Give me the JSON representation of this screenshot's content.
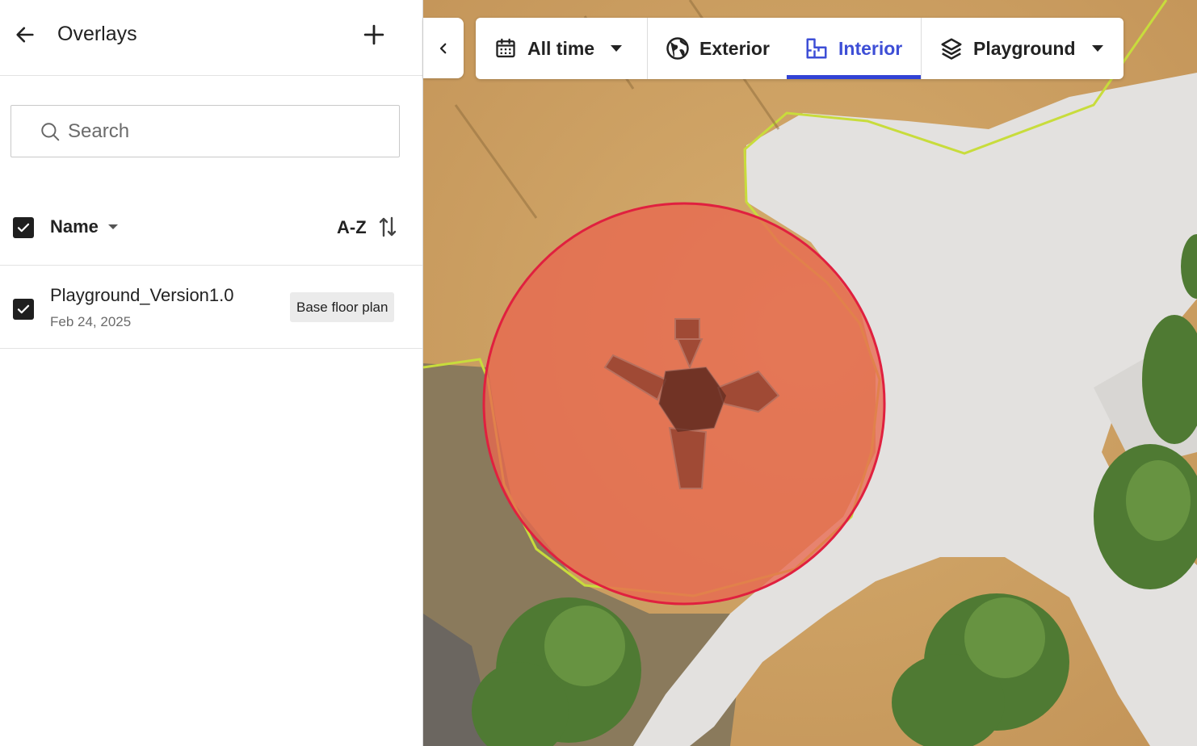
{
  "sidebar": {
    "title": "Overlays",
    "search": {
      "placeholder": "Search",
      "value": ""
    },
    "list_header": {
      "column_label": "Name",
      "sort_label": "A-Z",
      "all_checked": true
    },
    "items": [
      {
        "name": "Playground_Version1.0",
        "date": "Feb 24, 2025",
        "badge": "Base floor plan",
        "checked": true
      }
    ]
  },
  "toolbar": {
    "time_filter": "All time",
    "tabs": [
      {
        "label": "Exterior",
        "icon": "globe-icon",
        "active": false
      },
      {
        "label": "Interior",
        "icon": "floor-plan-icon",
        "active": true
      }
    ],
    "layer_select": "Playground"
  },
  "colors": {
    "accent": "#3243d4",
    "overlay_fill": "#e8684f",
    "overlay_stroke": "#e0203f",
    "boundary_stroke": "#c8dc3c"
  }
}
